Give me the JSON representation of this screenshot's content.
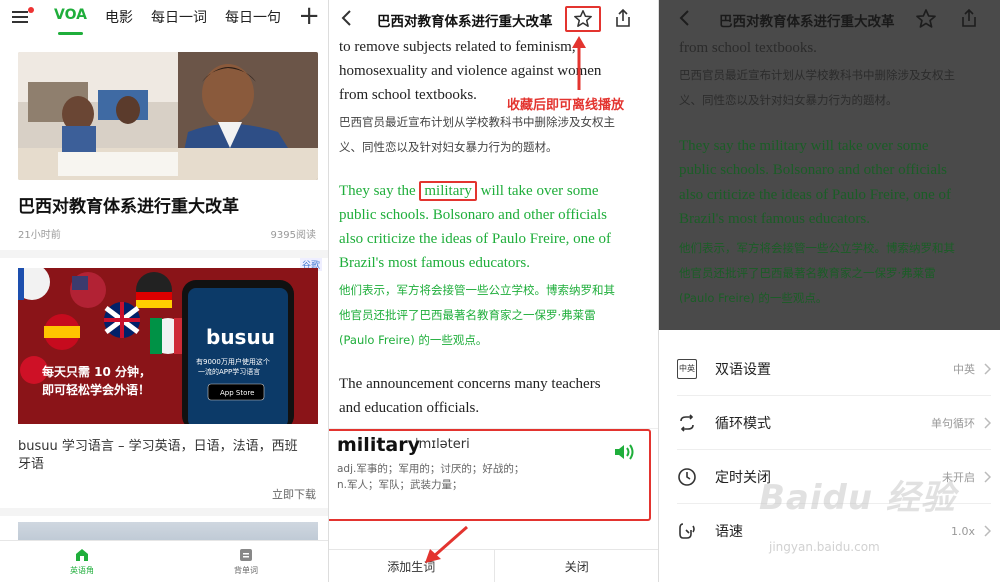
{
  "panel1": {
    "tabs": [
      "VOA",
      "电影",
      "每日一词",
      "每日一句"
    ],
    "article": {
      "title": "巴西对教育体系进行重大改革",
      "time": "21小时前",
      "reads": "9395阅读"
    },
    "ad": {
      "tag": "谷歌",
      "brand": "busuu",
      "brand_sub": "有9000万用户使用这个\n一流的APP学习语言",
      "appstore": "App Store",
      "headline_1": "每天只需 10 分钟，",
      "headline_2": "即可轻松学会外语！",
      "title": "busuu 学习语言 – 学习英语，日语，法语，西班牙语",
      "download": "立即下载"
    },
    "nav": [
      {
        "label": "英语角",
        "icon": "home-icon"
      },
      {
        "label": "背单词",
        "icon": "wordbook-icon"
      }
    ]
  },
  "panel2": {
    "title": "巴西对教育体系进行重大改革",
    "para1_en_1": "to remove subjects related to feminism,",
    "para1_en_2": "homosexuality and violence against women",
    "para1_en_3": "from school textbooks.",
    "para1_cn_1": "巴西官员最近宣布计划从学校教科书中删除涉及女权主",
    "para1_cn_2": "义、同性恋以及针对妇女暴力行为的题材。",
    "para2_en_1a": "They say the ",
    "para2_word": "military",
    "para2_en_1b": " will take over some",
    "para2_en_2": "public schools. Bolsonaro and other officials",
    "para2_en_3": "also criticize the ideas of Paulo Freire, one of",
    "para2_en_4": "Brazil's most famous educators.",
    "para2_cn_1": "他们表示，军方将会接管一些公立学校。博索纳罗和其",
    "para2_cn_2": "他官员还批评了巴西最著名教育家之一保罗·弗莱雷",
    "para2_cn_3": "(Paulo Freire) 的一些观点。",
    "para3_en_1": "The announcement concerns many teachers",
    "para3_en_2": "and education officials.",
    "tip": "收藏后即可离线播放",
    "dict": {
      "word": "military",
      "phonetic": "ˈmɪləteri",
      "def_adj": "adj.军事的；军用的；讨厌的；好战的；",
      "def_n": "n.军人；军队；武装力量；",
      "add_label": "添加生词",
      "close_label": "关闭"
    }
  },
  "panel3": {
    "title": "巴西对教育体系进行重大改革",
    "p_en_0": "from school textbooks.",
    "p_cn_1": "巴西官员最近宣布计划从学校教科书中删除涉及女权主",
    "p_cn_2": "义、同性恋以及针对妇女暴力行为的题材。",
    "p_en_1": "They say the military will take over some",
    "p_en_2": "public schools. Bolsonaro and other officials",
    "p_en_3": "also criticize the ideas of Paulo Freire, one of",
    "p_en_4": "Brazil's most famous educators.",
    "p_cn_3": "他们表示，军方将会接管一些公立学校。博索纳罗和其",
    "p_cn_4": "他官员还批评了巴西最著名教育家之一保罗·弗莱雷",
    "p_cn_5": "(Paulo Freire) 的一些观点。",
    "settings": [
      {
        "label": "双语设置",
        "value": "中英",
        "icon": "bilingual-icon",
        "icon_text": "中英"
      },
      {
        "label": "循环模式",
        "value": "单句循环",
        "icon": "loop-icon"
      },
      {
        "label": "定时关闭",
        "value": "未开启",
        "icon": "clock-icon"
      },
      {
        "label": "语速",
        "value": "1.0x",
        "icon": "speed-icon"
      }
    ],
    "watermark": "Baidu 经验",
    "watermark_url": "jingyan.baidu.com"
  },
  "colors": {
    "accent_green": "#1fae3b",
    "annotation_red": "#e3342f"
  }
}
